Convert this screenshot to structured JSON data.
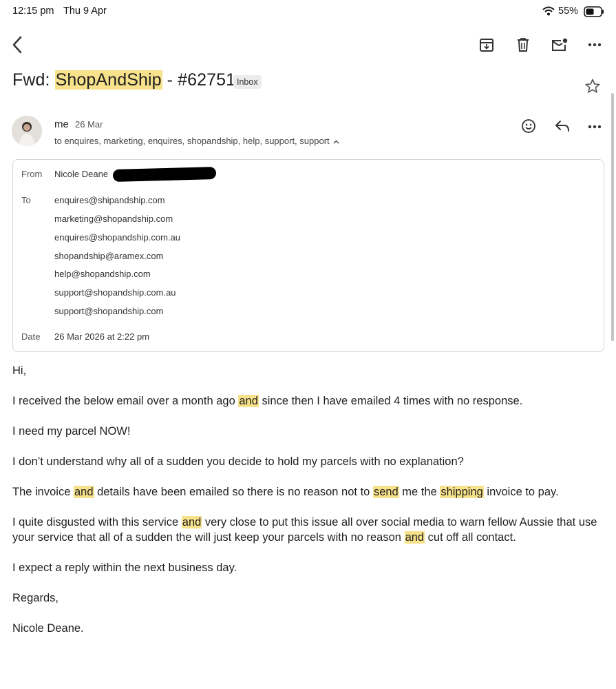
{
  "status_bar": {
    "time": "12:15 pm",
    "date": "Thu 9 Apr",
    "battery": "55%"
  },
  "subject": {
    "prefix": "Fwd: ",
    "highlighted": "ShopAndShip",
    "suffix": " - #62751c",
    "label_badge": "Inbox"
  },
  "sender": {
    "name": "me",
    "date": "26 Mar",
    "recipients_summary": "to enquires, marketing, enquires, shopandship, help, support, support"
  },
  "details": {
    "from_label": "From",
    "from_name": "Nicole Deane",
    "to_label": "To",
    "to": [
      "enquires@shipandship.com",
      "marketing@shopandship.com",
      "enquires@shopandship.com.au",
      "shopandship@aramex.com",
      "help@shopandship.com",
      "support@shopandship.com.au",
      "support@shopandship.com"
    ],
    "date_label": "Date",
    "date_value": "26 Mar 2026 at 2:22 pm"
  },
  "body": {
    "greeting": "Hi,",
    "p1": [
      "I received the below email over a month ago ",
      "and",
      " since then I have emailed 4 times with no response."
    ],
    "p2": "I need my parcel NOW!",
    "p3": "I don’t understand why all of a sudden you decide to hold my parcels with no explanation?",
    "p4": [
      "The invoice ",
      "and",
      " details have been emailed so there is no reason not to ",
      "send",
      " me the ",
      "shipping",
      " invoice to pay."
    ],
    "p5": [
      "I quite disgusted with this service ",
      "and",
      " very close to put this issue all over social media to warn fellow Aussie that use your service that all of a sudden the will just keep your parcels with no reason ",
      "and",
      " cut off all contact."
    ],
    "p6": "I expect a reply within the next business day.",
    "p7": "Regards,",
    "p8": "Nicole Deane."
  },
  "colors": {
    "highlight": "#f7e18a",
    "text": "#1f1f1f",
    "badge_bg": "#ececec"
  },
  "icons": [
    "back-arrow-icon",
    "archive-icon",
    "trash-icon",
    "mark-unread-icon",
    "more-icon",
    "star-icon",
    "emoji-icon",
    "reply-icon",
    "wifi-icon",
    "battery-icon",
    "chevron-up-icon"
  ]
}
